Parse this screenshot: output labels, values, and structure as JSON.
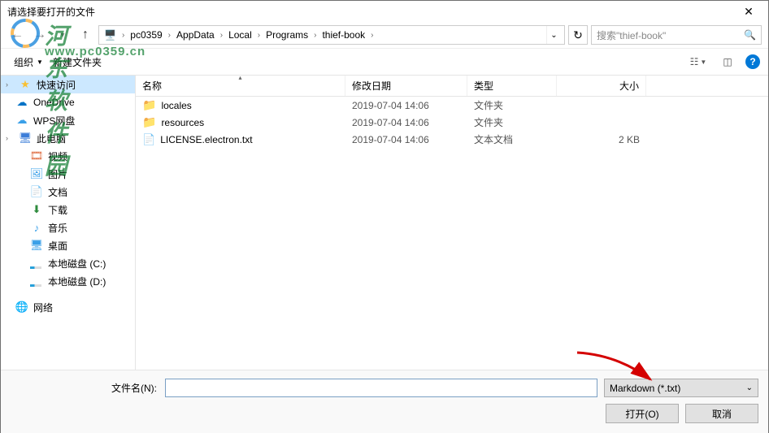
{
  "window": {
    "title": "请选择要打开的文件"
  },
  "watermark": {
    "brand": "河东软件园",
    "url": "www.pc0359.cn"
  },
  "nav": {
    "crumbs": [
      "pc0359",
      "AppData",
      "Local",
      "Programs",
      "thief-book"
    ],
    "search_placeholder": "搜索\"thief-book\""
  },
  "toolbar": {
    "organize": "组织",
    "newfolder": "新建文件夹"
  },
  "sidebar": [
    {
      "key": "quick",
      "label": "快速访问",
      "icon": "star",
      "active": true,
      "exp": true
    },
    {
      "key": "onedrive",
      "label": "OneDrive",
      "icon": "cloud-blue"
    },
    {
      "key": "wps",
      "label": "WPS网盘",
      "icon": "cloud-lt"
    },
    {
      "key": "pc",
      "label": "此电脑",
      "icon": "pc",
      "exp": true
    },
    {
      "key": "video",
      "label": "视频",
      "icon": "vid",
      "sub": true
    },
    {
      "key": "pictures",
      "label": "图片",
      "icon": "img",
      "sub": true
    },
    {
      "key": "documents",
      "label": "文档",
      "icon": "doc",
      "sub": true
    },
    {
      "key": "downloads",
      "label": "下载",
      "icon": "down",
      "sub": true
    },
    {
      "key": "music",
      "label": "音乐",
      "icon": "music",
      "sub": true
    },
    {
      "key": "desktop",
      "label": "桌面",
      "icon": "desk",
      "sub": true
    },
    {
      "key": "drivec",
      "label": "本地磁盘 (C:)",
      "icon": "drive",
      "sub": true,
      "bar": true
    },
    {
      "key": "drived",
      "label": "本地磁盘 (D:)",
      "icon": "drive",
      "sub": true,
      "bar": true
    },
    {
      "key": "network",
      "label": "网络",
      "icon": "net"
    }
  ],
  "columns": {
    "name": "名称",
    "date": "修改日期",
    "type": "类型",
    "size": "大小"
  },
  "files": [
    {
      "name": "locales",
      "date": "2019-07-04 14:06",
      "type": "文件夹",
      "size": "",
      "kind": "folder"
    },
    {
      "name": "resources",
      "date": "2019-07-04 14:06",
      "type": "文件夹",
      "size": "",
      "kind": "folder"
    },
    {
      "name": "LICENSE.electron.txt",
      "date": "2019-07-04 14:06",
      "type": "文本文档",
      "size": "2 KB",
      "kind": "txt"
    }
  ],
  "footer": {
    "filename_label": "文件名(N):",
    "filename_value": "",
    "filter": "Markdown (*.txt)",
    "open": "打开(O)",
    "cancel": "取消"
  }
}
